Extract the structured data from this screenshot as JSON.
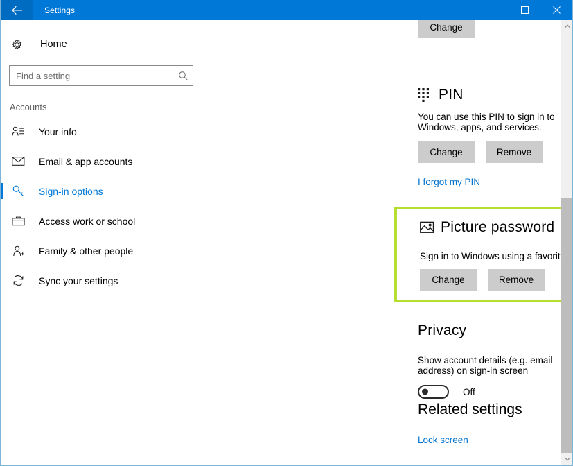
{
  "window": {
    "title": "Settings",
    "back_icon": "back-arrow-icon",
    "controls": {
      "minimize": "minimize-icon",
      "maximize": "maximize-icon",
      "close": "close-icon"
    },
    "accent_color": "#0078d7",
    "titlebar_color": "#0078d7",
    "back_button_color": "#006cc1"
  },
  "sidebar": {
    "home_label": "Home",
    "home_icon": "gear-icon",
    "search": {
      "placeholder": "Find a setting",
      "value": "",
      "icon": "search-icon"
    },
    "section_label": "Accounts",
    "items": [
      {
        "label": "Your info",
        "icon": "user-info-icon",
        "selected": false
      },
      {
        "label": "Email & app accounts",
        "icon": "envelope-icon",
        "selected": false
      },
      {
        "label": "Sign-in options",
        "icon": "key-icon",
        "selected": true
      },
      {
        "label": "Access work or school",
        "icon": "briefcase-icon",
        "selected": false
      },
      {
        "label": "Family & other people",
        "icon": "user-add-icon",
        "selected": false
      },
      {
        "label": "Sync your settings",
        "icon": "sync-icon",
        "selected": false
      }
    ],
    "selected_color": "#0078d7"
  },
  "content": {
    "top_partial_button": "Change",
    "pin": {
      "title": "PIN",
      "icon": "keypad-dots-icon",
      "description": "You can use this PIN to sign in to Windows, apps, and services.",
      "change_label": "Change",
      "remove_label": "Remove",
      "forgot_link": "I forgot my PIN"
    },
    "picture_password": {
      "title": "Picture password",
      "icon": "picture-icon",
      "description": "Sign in to Windows using a favorite photo",
      "change_label": "Change",
      "remove_label": "Remove",
      "highlight_color": "#b5dd32"
    },
    "privacy": {
      "title": "Privacy",
      "description": "Show account details (e.g. email address) on sign-in screen",
      "toggle_state": "Off",
      "toggle_on": false
    },
    "related_settings": {
      "title": "Related settings",
      "links": [
        {
          "label": "Lock screen"
        }
      ]
    },
    "link_color": "#0073cf",
    "button_color": "#cccccc"
  },
  "scrollbar": {
    "up_icon": "chevron-up-icon",
    "down_icon": "chevron-down-icon"
  }
}
